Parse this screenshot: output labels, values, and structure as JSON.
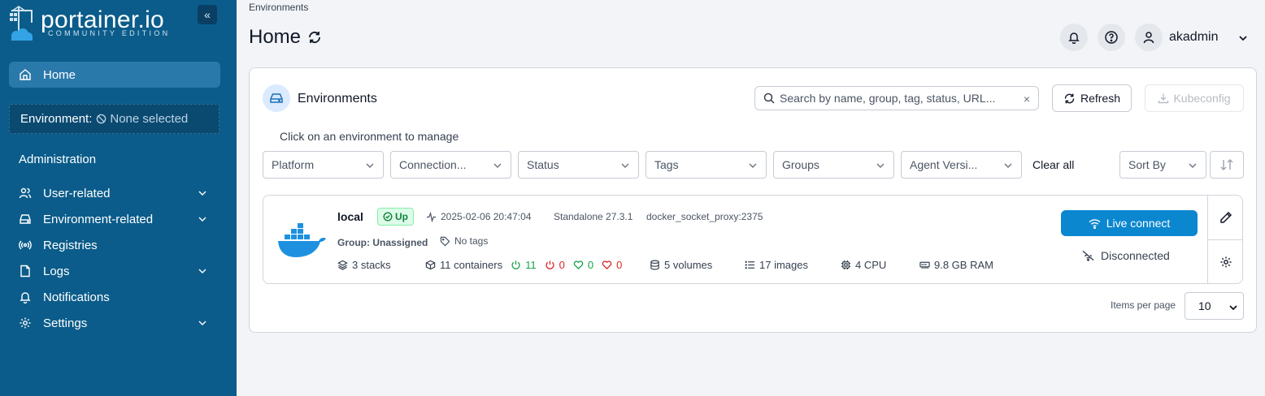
{
  "app": {
    "logo_text": "portainer.io",
    "logo_subtitle": "COMMUNITY EDITION"
  },
  "sidebar": {
    "collapse_glyph": "«",
    "home_label": "Home",
    "environment_label": "Environment:",
    "environment_value": "None selected",
    "section_title": "Administration",
    "items": [
      {
        "label": "User-related",
        "icon": "users-icon",
        "expandable": true
      },
      {
        "label": "Environment-related",
        "icon": "hard-drive-icon",
        "expandable": true
      },
      {
        "label": "Registries",
        "icon": "radio-icon",
        "expandable": false
      },
      {
        "label": "Logs",
        "icon": "file-icon",
        "expandable": true
      },
      {
        "label": "Notifications",
        "icon": "bell-icon",
        "expandable": false
      },
      {
        "label": "Settings",
        "icon": "gear-icon",
        "expandable": true
      }
    ]
  },
  "header": {
    "breadcrumb": "Environments",
    "title": "Home",
    "username": "akadmin"
  },
  "environments": {
    "title": "Environments",
    "search_placeholder": "Search by name, group, tag, status, URL...",
    "clear_glyph": "×",
    "refresh_label": "Refresh",
    "kubeconfig_label": "Kubeconfig",
    "hint": "Click on an environment to manage",
    "filters": [
      "Platform",
      "Connection...",
      "Status",
      "Tags",
      "Groups",
      "Agent Versi..."
    ],
    "clear_all": "Clear all",
    "sort_by": "Sort By",
    "items_per_page_label": "Items per page",
    "items_per_page": "10"
  },
  "env": {
    "name": "local",
    "status": "Up",
    "timestamp": "2025-02-06 20:47:04",
    "type": "Standalone 27.3.1",
    "url": "docker_socket_proxy:2375",
    "group": "Group: Unassigned",
    "tags": "No tags",
    "stacks": "3 stacks",
    "containers": "11 containers",
    "running": "11",
    "stopped": "0",
    "healthy": "0",
    "unhealthy": "0",
    "volumes": "5 volumes",
    "images": "17 images",
    "cpu": "4 CPU",
    "ram": "9.8 GB RAM",
    "live_connect": "Live connect",
    "connection_status": "Disconnected"
  },
  "colors": {
    "sidebar_bg": "#0b5c8a",
    "primary": "#0b87d0",
    "success": "#15803d"
  }
}
